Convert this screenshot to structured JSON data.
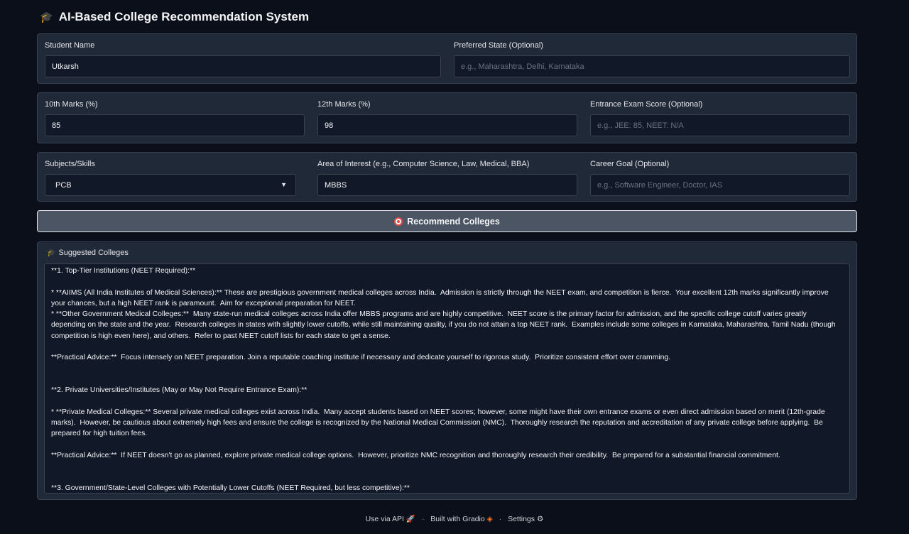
{
  "app": {
    "icon": "graduation-cap-icon",
    "title": "AI-Based College Recommendation System"
  },
  "row1": {
    "student_name": {
      "label": "Student Name",
      "value": "Utkarsh"
    },
    "preferred_state": {
      "label": "Preferred State (Optional)",
      "placeholder": "e.g., Maharashtra, Delhi, Karnataka"
    }
  },
  "row2": {
    "marks10": {
      "label": "10th Marks (%)",
      "value": "85"
    },
    "marks12": {
      "label": "12th Marks (%)",
      "value": "98"
    },
    "entrance": {
      "label": "Entrance Exam Score (Optional)",
      "placeholder": "e.g., JEE: 85, NEET: N/A"
    }
  },
  "row3": {
    "subjects": {
      "label": "Subjects/Skills",
      "value": "PCB"
    },
    "interest": {
      "label": "Area of Interest (e.g., Computer Science, Law, Medical, BBA)",
      "value": "MBBS"
    },
    "career": {
      "label": "Career Goal (Optional)",
      "placeholder": "e.g., Software Engineer, Doctor, IAS"
    }
  },
  "recommend_button": {
    "icon": "target-icon",
    "label": "Recommend Colleges"
  },
  "output": {
    "label": "Suggested Colleges",
    "text": "**1. Top-Tier Institutions (NEET Required):**\n\n* **AIIMS (All India Institutes of Medical Sciences):** These are prestigious government medical colleges across India.  Admission is strictly through the NEET exam, and competition is fierce.  Your excellent 12th marks significantly improve your chances, but a high NEET rank is paramount.  Aim for exceptional preparation for NEET.\n* **Other Government Medical Colleges:**  Many state-run medical colleges across India offer MBBS programs and are highly competitive.  NEET score is the primary factor for admission, and the specific college cutoff varies greatly depending on the state and the year.  Research colleges in states with slightly lower cutoffs, while still maintaining quality, if you do not attain a top NEET rank.  Examples include some colleges in Karnataka, Maharashtra, Tamil Nadu (though competition is high even here), and others.  Refer to past NEET cutoff lists for each state to get a sense.\n\n**Practical Advice:**  Focus intensely on NEET preparation. Join a reputable coaching institute if necessary and dedicate yourself to rigorous study.  Prioritize consistent effort over cramming.\n\n\n**2. Private Universities/Institutes (May or May Not Require Entrance Exam):**\n\n* **Private Medical Colleges:** Several private medical colleges exist across India.  Many accept students based on NEET scores; however, some might have their own entrance exams or even direct admission based on merit (12th-grade marks).  However, be cautious about extremely high fees and ensure the college is recognized by the National Medical Commission (NMC).  Thoroughly research the reputation and accreditation of any private college before applying.  Be prepared for high tuition fees.\n\n**Practical Advice:**  If NEET doesn't go as planned, explore private medical college options.  However, prioritize NMC recognition and thoroughly research their credibility.  Be prepared for a substantial financial commitment.\n\n\n**3. Government/State-Level Colleges with Potentially Lower Cutoffs (NEET Required, but less competitive):**"
  },
  "footer": {
    "api": "Use via API",
    "api_icon": "rocket-icon",
    "gradio": "Built with Gradio",
    "gradio_icon": "gradio-logo-icon",
    "settings": "Settings",
    "settings_icon": "gear-icon",
    "separator": "·"
  }
}
